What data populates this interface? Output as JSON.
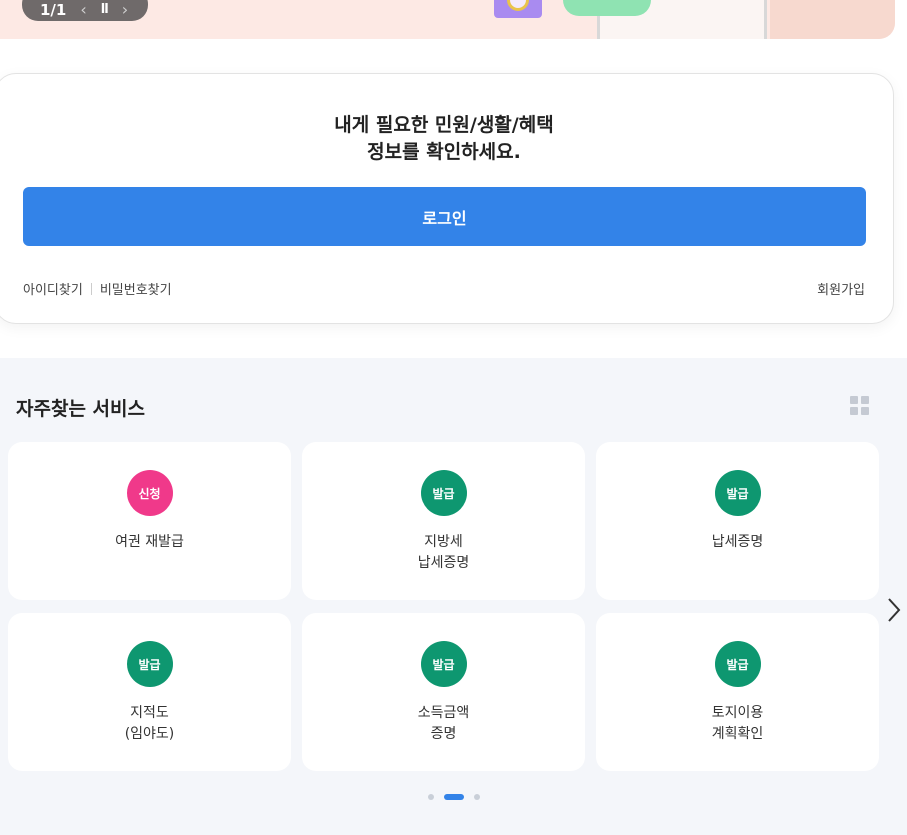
{
  "banner": {
    "counter": "1/1",
    "prev_icon": "‹",
    "pause_icon": "ll",
    "next_icon": "›"
  },
  "login": {
    "title_line1": "내게 필요한 민원/생활/혜택",
    "title_line2": "정보를 확인하세요.",
    "login_button": "로그인",
    "find_id": "아이디찾기",
    "find_password": "비밀번호찾기",
    "signup": "회원가입"
  },
  "services": {
    "title": "자주찾는 서비스",
    "items": [
      {
        "badge": "신청",
        "badge_color": "#f0398a",
        "label": "여권 재발급"
      },
      {
        "badge": "발급",
        "badge_color": "#0e9770",
        "label": "지방세\n납세증명"
      },
      {
        "badge": "발급",
        "badge_color": "#0e9770",
        "label": "납세증명"
      },
      {
        "badge": "발급",
        "badge_color": "#0e9770",
        "label": "지적도\n(임야도)"
      },
      {
        "badge": "발급",
        "badge_color": "#0e9770",
        "label": "소득금액\n증명"
      },
      {
        "badge": "발급",
        "badge_color": "#0e9770",
        "label": "토지이용\n계획확인"
      }
    ]
  },
  "pagination": {
    "pages": 3,
    "active_index": 1
  },
  "colors": {
    "primary": "#3383e8",
    "apply": "#f0398a",
    "issue": "#0e9770"
  }
}
